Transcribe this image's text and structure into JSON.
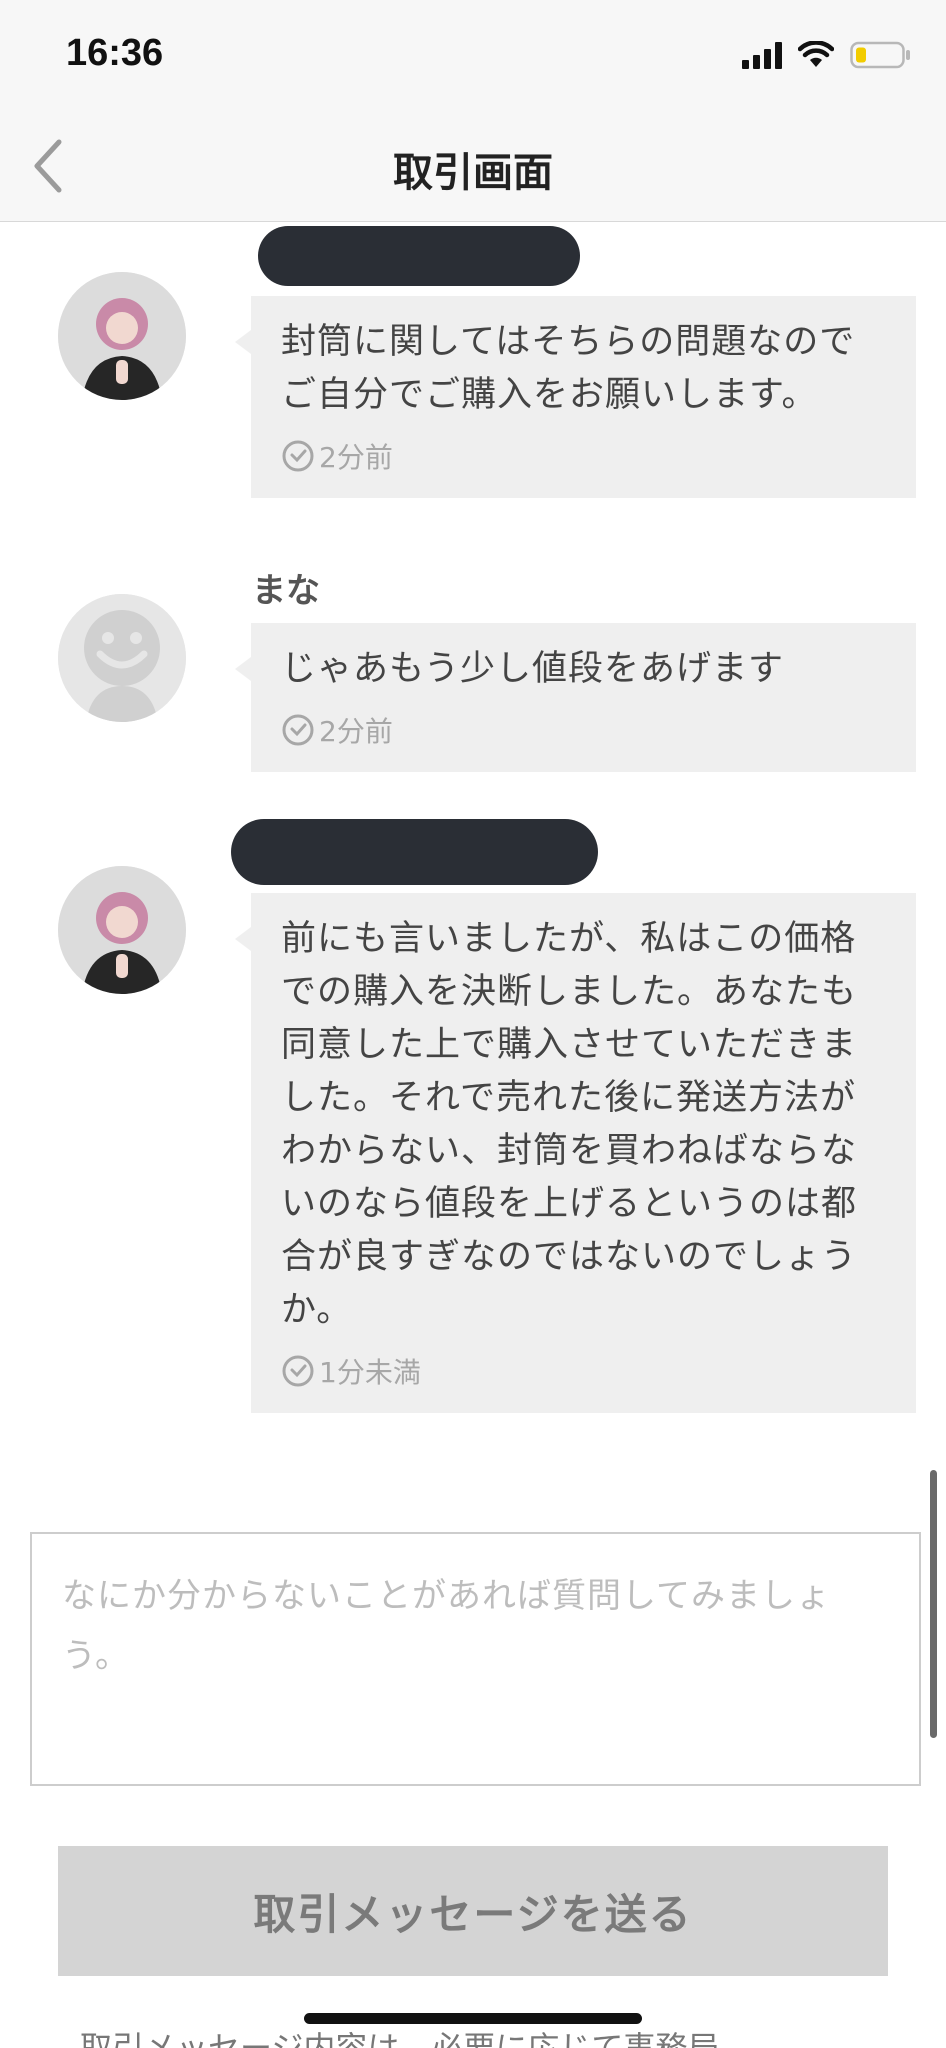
{
  "status_bar": {
    "time": "16:36"
  },
  "nav": {
    "title": "取引画面"
  },
  "messages": [
    {
      "sender": "",
      "text": "封筒に関してはそちらの問題なのでご自分でご購入をお願いします。",
      "time": "2分前"
    },
    {
      "sender": "まな",
      "text": "じゃあもう少し値段をあげます",
      "time": "2分前"
    },
    {
      "sender": "",
      "text": "前にも言いましたが、私はこの価格での購入を決断しました。あなたも同意した上で購入させていただきました。それで売れた後に発送方法がわからない、封筒を買わねばならないのなら値段を上げるというのは都合が良すぎなのではないのでしょうか。",
      "time": "1分未満"
    }
  ],
  "input": {
    "placeholder": "なにか分からないことがあれば質問してみましょう。"
  },
  "send_button": {
    "label": "取引メッセージを送る"
  },
  "footer": {
    "text": "取引メッセージ内容は、必要に応じて事務局"
  },
  "colors": {
    "bubble": "#efefef",
    "button": "#d4d4d4",
    "redaction": "#2a2e35"
  },
  "icons": [
    "back-chevron-icon",
    "clock-icon",
    "signal-icon",
    "wifi-icon",
    "battery-icon",
    "default-avatar-icon"
  ]
}
